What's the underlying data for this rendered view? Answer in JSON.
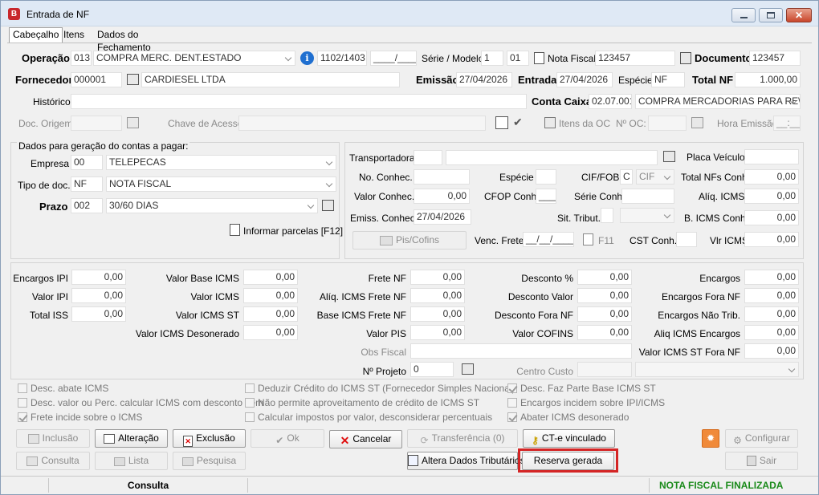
{
  "window": {
    "title": "Entrada de NF",
    "app_icon_letter": "B"
  },
  "tabs": [
    "Cabeçalho",
    "Itens",
    "Dados do Fechamento"
  ],
  "header": {
    "operacao_label": "Operação",
    "operacao_code": "013",
    "operacao_desc": "COMPRA MERC. DENT.ESTADO",
    "cfop": "1102/1403",
    "cfop_extra": "____/____",
    "serie_modelo_label": "Série / Modelo",
    "serie": "1",
    "modelo": "01",
    "nota_fiscal_label": "Nota Fiscal",
    "nota_fiscal": "123457",
    "documento_label": "Documento",
    "documento": "123457",
    "fornecedor_label": "Fornecedor",
    "fornecedor_code": "000001",
    "fornecedor_name": "CARDIESEL LTDA",
    "emissao_label": "Emissão",
    "emissao": "27/04/2026",
    "entrada_label": "Entrada",
    "entrada": "27/04/2026",
    "especie_label": "Espécie",
    "especie": "NF",
    "total_nf_label": "Total NF",
    "total_nf": "1.000,00",
    "historico_label": "Histórico",
    "conta_caixa_label": "Conta Caixa",
    "conta_caixa_code": "02.07.001",
    "conta_caixa_desc": "COMPRA MERCADORIAS PARA RE\\",
    "doc_origem_label": "Doc. Origem",
    "chave_acesso_label": "Chave de Acesso",
    "itens_oc_label": "Itens da OC",
    "n_oc_label": "Nº OC:",
    "hora_emissao_label": "Hora Emissão",
    "hora_emissao": "__:__"
  },
  "contas": {
    "title": "Dados para geração do contas a pagar:",
    "empresa_label": "Empresa",
    "empresa_code": "00",
    "empresa_name": "TELEPECAS",
    "tipo_doc_label": "Tipo de doc.",
    "tipo_doc_code": "NF",
    "tipo_doc_name": "NOTA FISCAL",
    "prazo_label": "Prazo",
    "prazo_code": "002",
    "prazo_name": "30/60 DIAS",
    "parcelas_label": "Informar parcelas [F12]"
  },
  "transp": {
    "transportadora_label": "Transportadora",
    "placa_label": "Placa Veículo",
    "no_conhec_label": "No. Conhec.",
    "especie_label": "Espécie",
    "cif_fob_label": "CIF/FOB",
    "cif_code": "C",
    "cif_combo": "CIF",
    "total_nfs_conh_label": "Total NFs Conh.",
    "total_nfs_conh": "0,00",
    "valor_conhec_label": "Valor Conhec.",
    "valor_conhec": "0,00",
    "cfop_conh_label": "CFOP Conh.",
    "cfop_conh": "____",
    "serie_conh_label": "Série Conh.",
    "aliq_icms_label": "Alíq. ICMS",
    "aliq_icms": "0,00",
    "emiss_conhec_label": "Emiss. Conhec.",
    "emiss_conhec": "27/04/2026",
    "sit_tribut_label": "Sit. Tribut.",
    "b_icms_conh_label": "B. ICMS Conh.",
    "b_icms_conh": "0,00",
    "pis_cofins_label": "Pis/Cofins",
    "venc_frete_label": "Venc. Frete",
    "venc_frete": "__/__/____",
    "f11_label": "F11",
    "cst_conh_label": "CST Conh.",
    "vlr_icms_label": "Vlr ICMS",
    "vlr_icms": "0,00"
  },
  "totals": {
    "encargos_ipi_label": "Encargos IPI",
    "encargos_ipi": "0,00",
    "valor_ipi_label": "Valor IPI",
    "valor_ipi": "0,00",
    "total_iss_label": "Total ISS",
    "total_iss": "0,00",
    "valor_base_icms_label": "Valor Base ICMS",
    "valor_base_icms": "0,00",
    "valor_icms_label": "Valor ICMS",
    "valor_icms": "0,00",
    "valor_icms_st_label": "Valor ICMS ST",
    "valor_icms_st": "0,00",
    "valor_icms_desonerado_label": "Valor ICMS Desonerado",
    "valor_icms_desonerado": "0,00",
    "frete_nf_label": "Frete NF",
    "frete_nf": "0,00",
    "aliq_icms_frete_label": "Alíq. ICMS Frete NF",
    "aliq_icms_frete": "0,00",
    "base_icms_frete_label": "Base ICMS Frete NF",
    "base_icms_frete": "0,00",
    "valor_pis_label": "Valor PIS",
    "valor_pis": "0,00",
    "obs_fiscal_label": "Obs Fiscal",
    "n_projeto_label": "Nº Projeto",
    "n_projeto": "0",
    "desconto_pct_label": "Desconto %",
    "desconto_pct": "0,00",
    "desconto_valor_label": "Desconto Valor",
    "desconto_valor": "0,00",
    "desconto_fora_label": "Desconto Fora NF",
    "desconto_fora": "0,00",
    "valor_cofins_label": "Valor COFINS",
    "valor_cofins": "0,00",
    "centro_custo_label": "Centro Custo",
    "encargos_label": "Encargos",
    "encargos": "0,00",
    "encargos_fora_label": "Encargos Fora NF",
    "encargos_fora": "0,00",
    "encargos_nao_trib_label": "Encargos Não Trib.",
    "encargos_nao_trib": "0,00",
    "aliq_icms_encargos_label": "Aliq ICMS Encargos",
    "aliq_icms_encargos": "0,00",
    "valor_icms_st_fora_label": "Valor ICMS ST Fora NF",
    "valor_icms_st_fora": "0,00"
  },
  "checks": [
    {
      "label": "Desc. abate ICMS",
      "checked": false
    },
    {
      "label": "Desc. valor ou Perc. calcular ICMS com desconto item",
      "checked": false
    },
    {
      "label": "Frete incide sobre o ICMS",
      "checked": true
    },
    {
      "label": "Deduzir Crédito do ICMS ST (Fornecedor Simples Nacional)",
      "checked": false
    },
    {
      "label": "Não permite aproveitamento de crédito de ICMS ST",
      "checked": false
    },
    {
      "label": "Calcular impostos por valor, desconsiderar percentuais",
      "checked": false
    },
    {
      "label": "Desc. Faz Parte Base ICMS ST",
      "checked": true
    },
    {
      "label": "Encargos incidem sobre IPI/ICMS",
      "checked": false
    },
    {
      "label": "Abater ICMS desonerado",
      "checked": true
    }
  ],
  "buttons": {
    "inclusao": "Inclusão",
    "alteracao": "Alteração",
    "exclusao": "Exclusão",
    "ok": "Ok",
    "cancelar": "Cancelar",
    "transferencia": "Transferência (0)",
    "cte_vinculado": "CT-e vinculado",
    "configurar": "Configurar",
    "consulta": "Consulta",
    "lista": "Lista",
    "pesquisa": "Pesquisa",
    "altera_dados": "Altera Dados Tributários",
    "reserva_gerada": "Reserva gerada",
    "sair": "Sair"
  },
  "status": {
    "mode": "Consulta",
    "state": "NOTA FISCAL FINALIZADA",
    "state_color": "#1a8a1a"
  }
}
